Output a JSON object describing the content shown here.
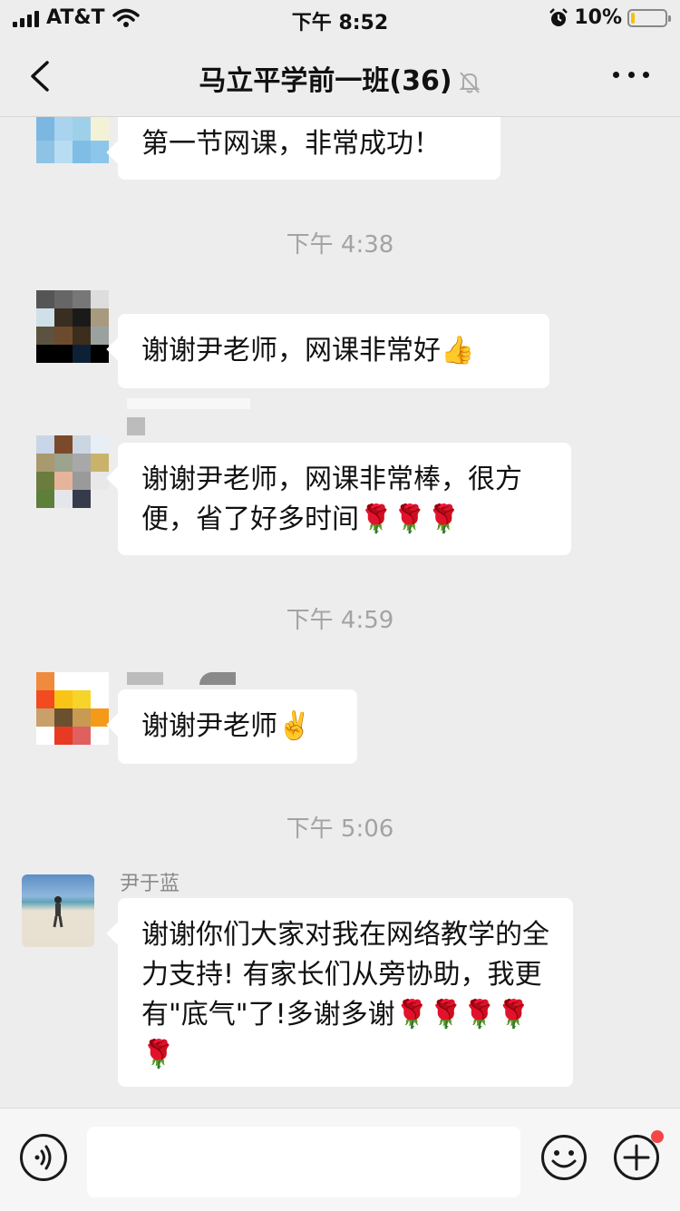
{
  "status_bar": {
    "carrier": "AT&T",
    "time": "下午 8:52",
    "battery_percent": "10%",
    "battery_level": 0.1
  },
  "nav": {
    "title": "马立平学前一班(36)",
    "muted": true
  },
  "messages": [
    {
      "type": "text",
      "text": "第一节网课，非常成功！"
    },
    {
      "type": "time",
      "text": "下午 4:38"
    },
    {
      "type": "text",
      "text": "谢谢尹老师，网课非常好👍"
    },
    {
      "type": "text",
      "text": "谢谢尹老师，网课非常棒，很方便，省了好多时间🌹🌹🌹"
    },
    {
      "type": "time",
      "text": "下午 4:59"
    },
    {
      "type": "text",
      "text": "谢谢尹老师✌️"
    },
    {
      "type": "time",
      "text": "下午 5:06"
    },
    {
      "type": "text",
      "sender": "尹于蓝",
      "text": "谢谢你们大家对我在网络教学的全力支持! 有家长们从旁协助，我更有\"底气\"了!多谢多谢🌹🌹🌹🌹🌹"
    }
  ],
  "input_bar": {
    "voice_icon": "voice-icon",
    "emoji_icon": "emoji-icon",
    "plus_icon": "plus-icon",
    "has_notification_dot": true,
    "dot_color": "#f54545"
  }
}
